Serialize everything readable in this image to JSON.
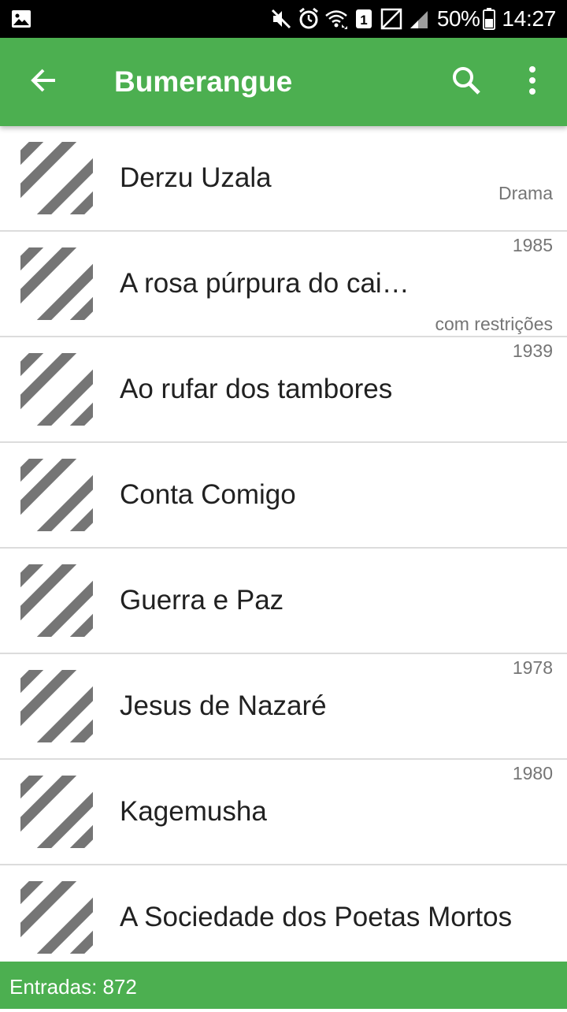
{
  "status_bar": {
    "battery": "50%",
    "time": "14:27",
    "sim_slot": "1",
    "icons": [
      "image-icon",
      "mute-icon",
      "alarm-icon",
      "wifi-icon",
      "sim-icon",
      "no-signal-icon",
      "signal-icon",
      "battery-icon"
    ]
  },
  "app_bar": {
    "title": "Bumerangue",
    "background_color": "#4caf50",
    "icons": [
      "back-arrow-icon",
      "search-icon",
      "more-vert-icon"
    ]
  },
  "list": {
    "items": [
      {
        "title": "Derzu Uzala",
        "year": "",
        "genre": "Drama",
        "note": ""
      },
      {
        "title": "A rosa púrpura do cai…",
        "year": "1985",
        "genre": "",
        "note": "com restrições"
      },
      {
        "title": "Ao rufar dos tambores",
        "year": "1939",
        "genre": "",
        "note": ""
      },
      {
        "title": "Conta Comigo",
        "year": "",
        "genre": "",
        "note": ""
      },
      {
        "title": "Guerra e Paz",
        "year": "",
        "genre": "",
        "note": ""
      },
      {
        "title": "Jesus de Nazaré",
        "year": "1978",
        "genre": "",
        "note": ""
      },
      {
        "title": "Kagemusha",
        "year": "1980",
        "genre": "",
        "note": ""
      },
      {
        "title": "A Sociedade dos Poetas Mortos",
        "year": "",
        "genre": "",
        "note": ""
      }
    ],
    "thumbnail_icon": "placeholder-striped-icon"
  },
  "footer": {
    "entries_label": "Entradas: 872"
  }
}
